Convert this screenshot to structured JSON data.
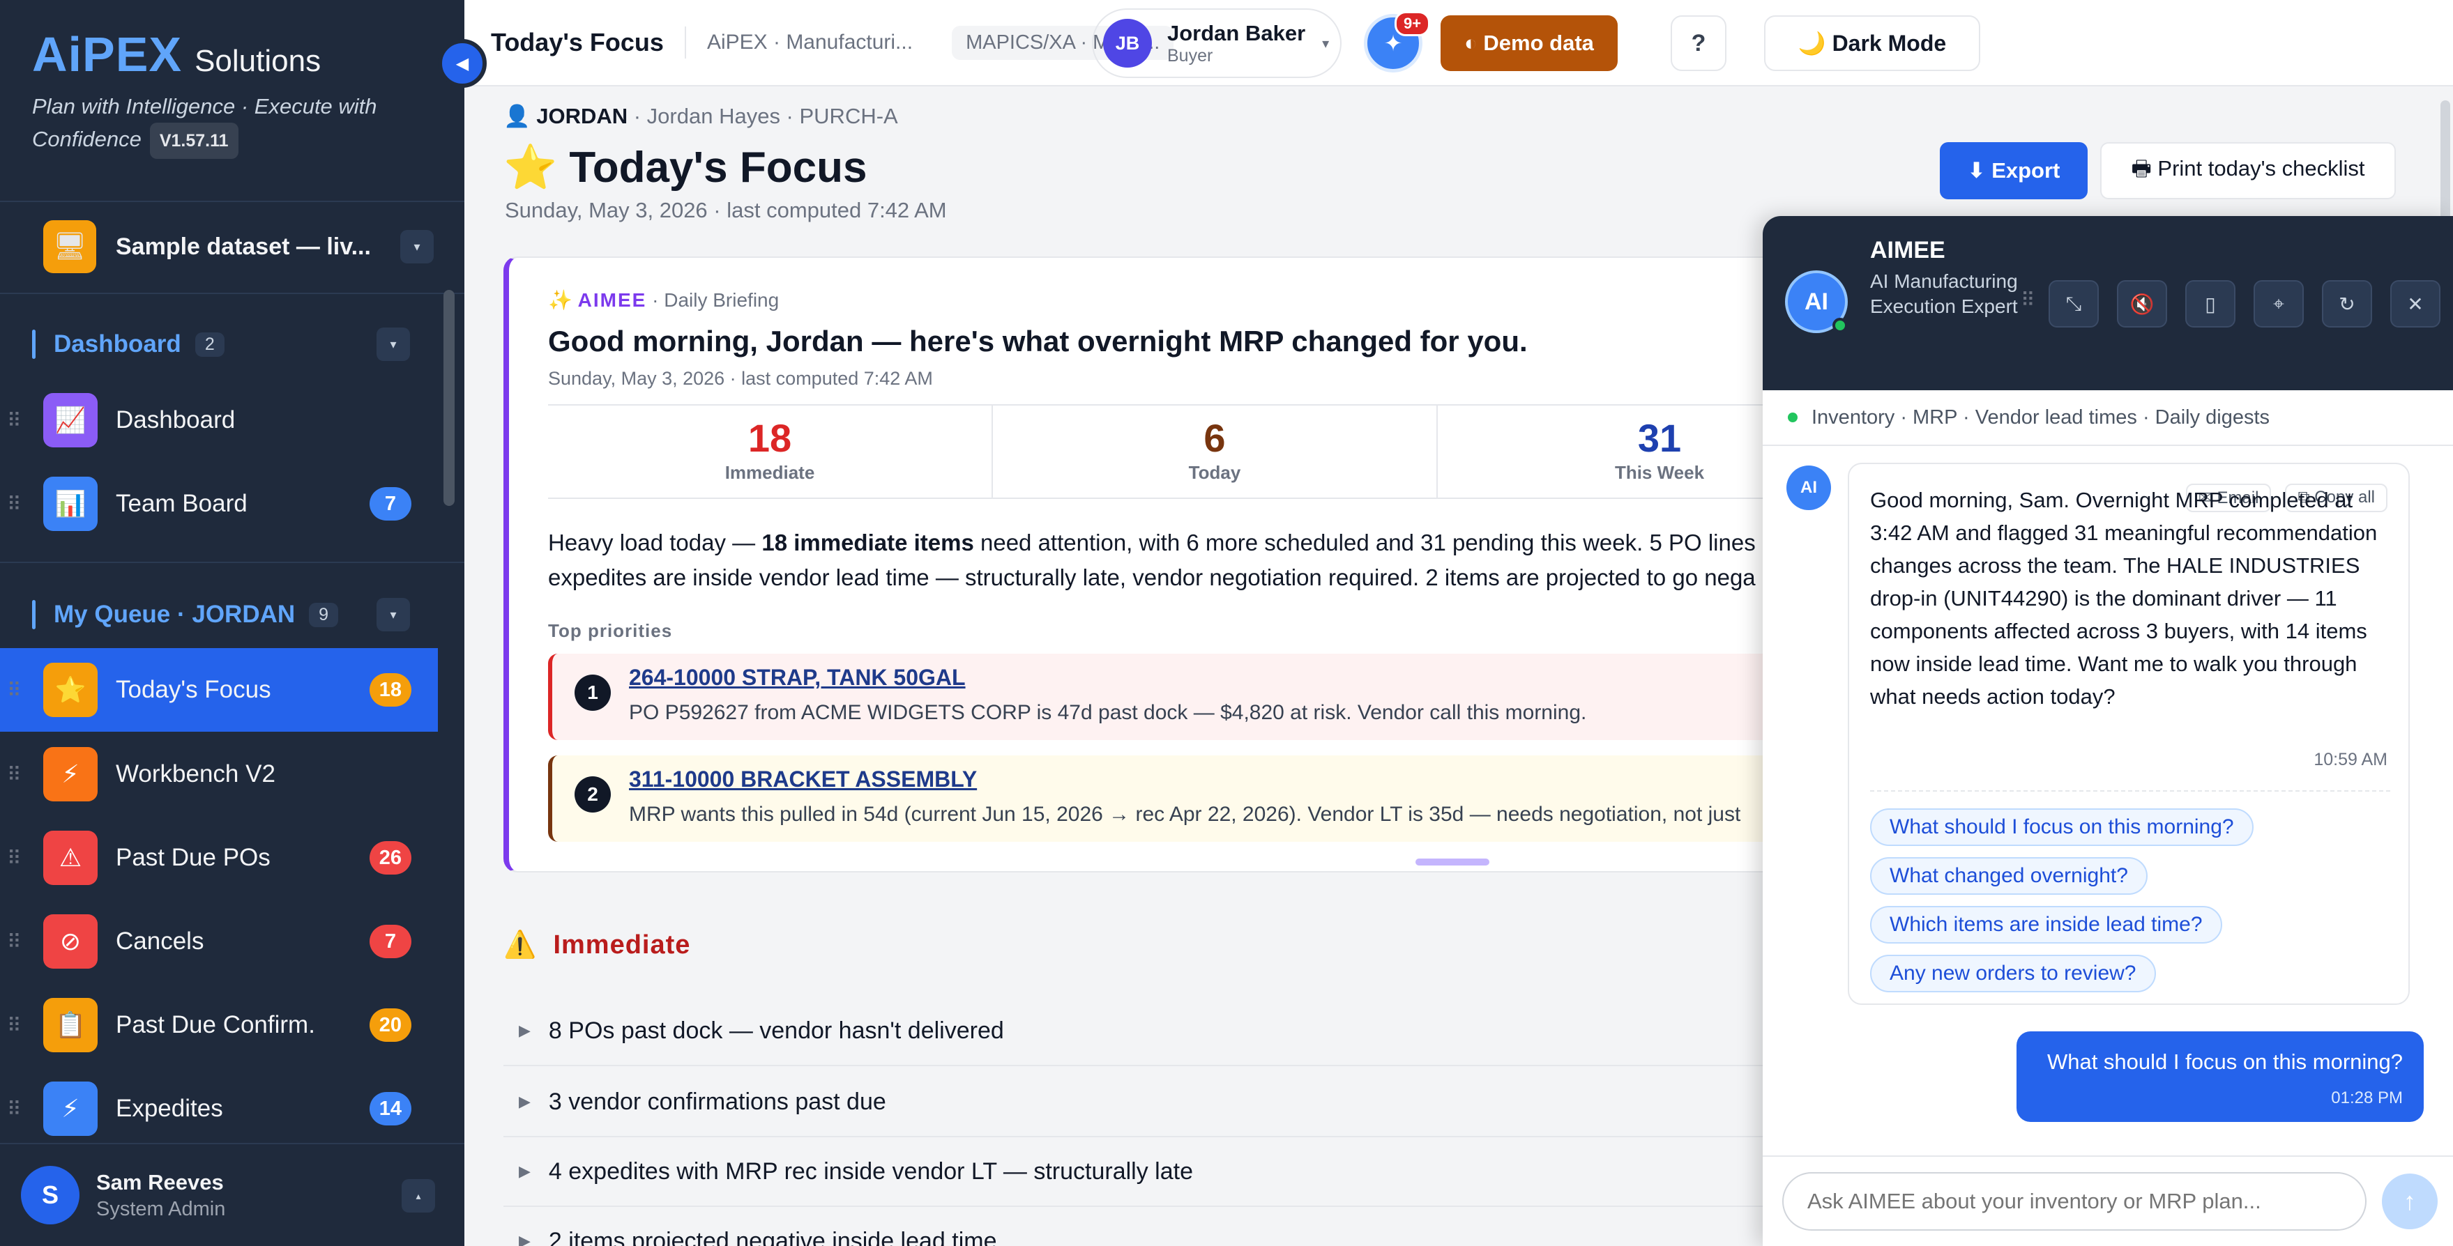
{
  "sidebar": {
    "brand": {
      "logo": "AiPEX",
      "subtitle": "Solutions",
      "tagline": "Plan with Intelligence · Execute with Confidence",
      "version": "V1.57.11"
    },
    "dataset": {
      "label": "Sample dataset — liv...",
      "icon": "monitor-icon"
    },
    "sections": [
      {
        "title": "Dashboard",
        "count": "2",
        "items": [
          {
            "label": "Dashboard",
            "icon": "chart-trend-icon",
            "color": "#8b5cf6"
          },
          {
            "label": "Team Board",
            "icon": "bar-chart-icon",
            "color": "#3b82f6",
            "badge": "7",
            "badge_color": "#3b82f6"
          }
        ]
      },
      {
        "title": "My Queue · JORDAN",
        "count": "9",
        "items": [
          {
            "label": "Today's Focus",
            "icon": "star-icon",
            "color": "#f59e0b",
            "badge": "18",
            "badge_color": "#f59e0b",
            "active": true
          },
          {
            "label": "Workbench V2",
            "icon": "lightning-icon",
            "color": "#f97316"
          },
          {
            "label": "Past Due POs",
            "icon": "warning-icon",
            "color": "#ef4444",
            "badge": "26",
            "badge_color": "#ef4444"
          },
          {
            "label": "Cancels",
            "icon": "cancel-icon",
            "color": "#ef4444",
            "badge": "7",
            "badge_color": "#ef4444"
          },
          {
            "label": "Past Due Confirm.",
            "icon": "clipboard-icon",
            "color": "#f59e0b",
            "badge": "20",
            "badge_color": "#f59e0b"
          },
          {
            "label": "Expedites",
            "icon": "lightning-icon",
            "color": "#3b82f6",
            "badge": "14",
            "badge_color": "#3b82f6"
          }
        ]
      }
    ],
    "user": {
      "initial": "S",
      "name": "Sam Reeves",
      "role": "System Admin"
    }
  },
  "topbar": {
    "title": "Today's Focus",
    "breadcrumb": "AiPEX · Manufacturi...",
    "chip": "MAPICS/XA · MRP ...",
    "user": {
      "initials": "JB",
      "name": "Jordan Baker",
      "role": "Buyer"
    },
    "notifications": "9+",
    "demo_label": "◐ Demo data",
    "help_label": "?",
    "dark_label": "🌙  Dark Mode"
  },
  "page": {
    "owner_short": "JORDAN",
    "owner_detail": " · Jordan Hayes · PURCH-A",
    "title": "⭐ Today's Focus",
    "date": "Sunday, May 3, 2026 · last computed 7:42 AM",
    "export_label": "⬇ Export",
    "print_label": "🖶 Print today's checklist"
  },
  "briefing": {
    "source": "AIMEE",
    "kind": " · Daily Briefing",
    "title": "Good morning, Jordan — here's what overnight MRP changed for you.",
    "date": "Sunday, May 3, 2026 · last computed 7:42 AM",
    "stats": [
      {
        "value": "18",
        "label": "Immediate",
        "color": "#dc2626"
      },
      {
        "value": "6",
        "label": "Today",
        "color": "#78350f"
      },
      {
        "value": "31",
        "label": "This Week",
        "color": "#1e40af"
      }
    ],
    "body_pre": "Heavy load today — ",
    "body_bold": "18 immediate items",
    "body_post": " need attention, with 6 more scheduled and 31 pending this week. 5 PO lines (",
    "body_line2": "expedites are inside vendor lead time — structurally late, vendor negotiation required. 2 items are projected to go nega",
    "priorities_label": "Top priorities",
    "priorities": [
      {
        "num": "1",
        "item": "264-10000 STRAP, TANK 50GAL",
        "text": "PO P592627 from ACME WIDGETS CORP is 47d past dock — $4,820 at risk. Vendor call this morning."
      },
      {
        "num": "2",
        "item": "311-10000 BRACKET ASSEMBLY",
        "text": "MRP wants this pulled in 54d (current Jun 15, 2026 → rec Apr 22, 2026). Vendor LT is 35d — needs negotiation, not just"
      }
    ]
  },
  "immediate": {
    "title": "Immediate",
    "rows": [
      "8 POs past dock — vendor hasn't delivered",
      "3 vendor confirmations past due",
      "4 expedites with MRP rec inside vendor LT — structurally late",
      "2 items projected negative inside lead time"
    ]
  },
  "aimee": {
    "name": "AIMEE",
    "description": "AI Manufacturing Execution Expert",
    "avatar": "AI",
    "context": "Inventory · MRP · Vendor lead times · Daily digests",
    "message": {
      "email_label": "✉ Email",
      "copy_label": "⧉ Copy all",
      "text": "Good morning, Sam. Overnight MRP completed at 3:42 AM and flagged 31 meaningful recommendation changes across the team. The HALE INDUSTRIES drop-in (UNIT44290) is the dominant driver — 11 components affected across 3 buyers, with 14 items now inside lead time. Want me to walk you through what needs action today?",
      "time": "10:59 AM",
      "suggestions": [
        "What should I focus on this morning?",
        "What changed overnight?",
        "Which items are inside lead time?",
        "Any new orders to review?"
      ]
    },
    "user_message": {
      "text": "What should I focus on this morning?",
      "time": "01:28 PM"
    },
    "input_placeholder": "Ask AIMEE about your inventory or MRP plan..."
  }
}
